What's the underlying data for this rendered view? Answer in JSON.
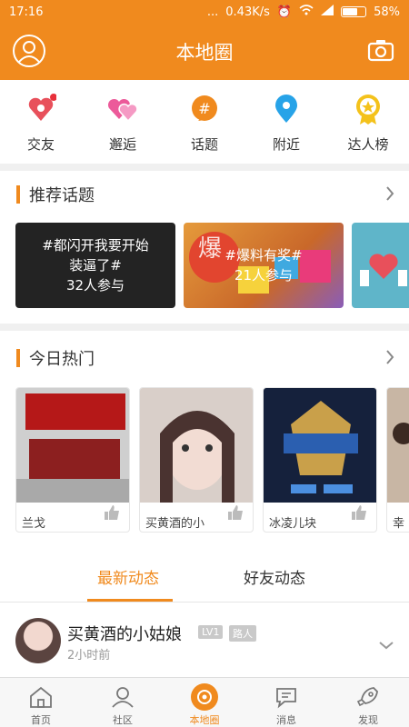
{
  "status": {
    "time": "17:16",
    "dots": "...",
    "speed": "0.43K/s",
    "battery": "58%"
  },
  "header": {
    "title": "本地圈"
  },
  "categories": [
    {
      "label": "交友",
      "icon": "heart-pin-icon",
      "color": "#e8505b"
    },
    {
      "label": "邂逅",
      "icon": "double-heart-icon",
      "color": "#ec5a9a"
    },
    {
      "label": "话题",
      "icon": "hash-bubble-icon",
      "color": "#f08a1e"
    },
    {
      "label": "附近",
      "icon": "location-pin-icon",
      "color": "#27a3e8"
    },
    {
      "label": "达人榜",
      "icon": "medal-icon",
      "color": "#f4c21b"
    }
  ],
  "recommended": {
    "heading": "推荐话题",
    "topics": [
      {
        "title": "#都闪开我要开始装逼了#",
        "count": "32人参与"
      },
      {
        "title": "#爆料有奖#",
        "count": "21人参与",
        "bg_text": "爆"
      }
    ]
  },
  "hot": {
    "heading": "今日热门",
    "items": [
      {
        "caption": "兰戈"
      },
      {
        "caption": "买黄酒的小"
      },
      {
        "caption": "冰凌儿块"
      },
      {
        "caption": "幸"
      }
    ]
  },
  "tabs": {
    "latest": "最新动态",
    "friends": "好友动态"
  },
  "post": {
    "name": "买黄酒的小姑娘",
    "level": "LV1",
    "tag": "路人",
    "time": "2小时前"
  },
  "nav": [
    {
      "label": "首页",
      "icon": "home-icon"
    },
    {
      "label": "社区",
      "icon": "community-icon"
    },
    {
      "label": "本地圈",
      "icon": "local-circle-icon"
    },
    {
      "label": "消息",
      "icon": "message-icon"
    },
    {
      "label": "发现",
      "icon": "rocket-icon"
    }
  ],
  "accent": "#f08a1e"
}
